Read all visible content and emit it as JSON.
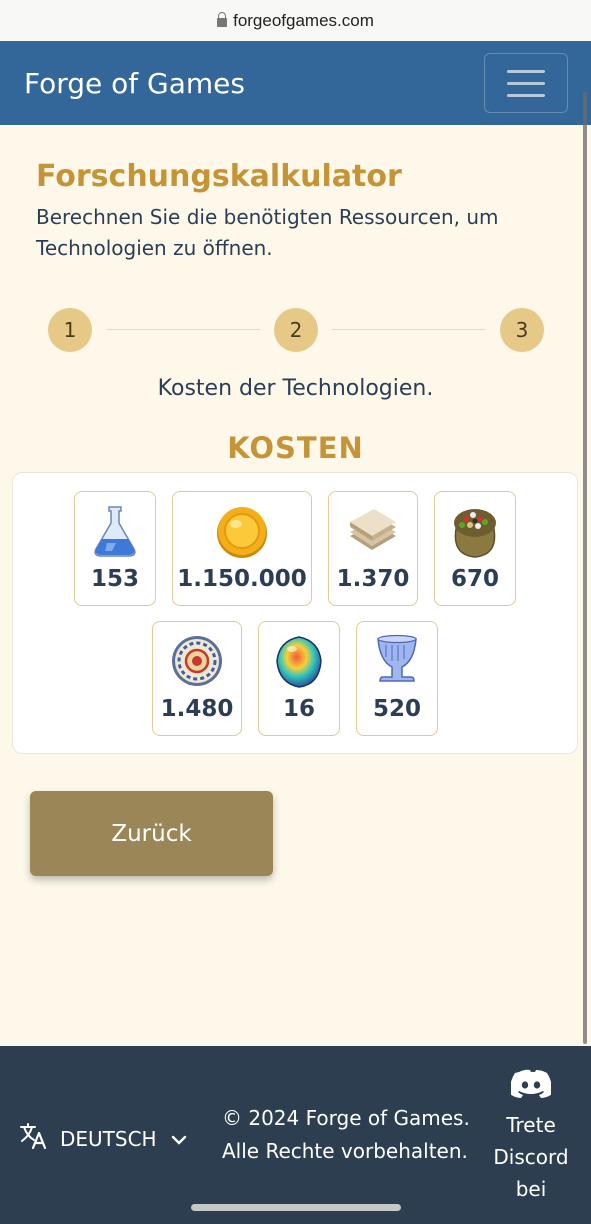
{
  "browser": {
    "url": "forgeofgames.com"
  },
  "navbar": {
    "brand": "Forge of Games"
  },
  "main": {
    "title": "Forschungskalkulator",
    "subtitle": "Berechnen Sie die benötigten Ressourcen, um Technologien zu öffnen.",
    "steps": [
      "1",
      "2",
      "3"
    ],
    "step_description": "Kosten der Technologien.",
    "costs_heading": "KOSTEN",
    "costs": [
      {
        "icon": "research-flask-icon",
        "value": "153"
      },
      {
        "icon": "coins-icon",
        "value": "1.150.000"
      },
      {
        "icon": "paper-stack-icon",
        "value": "1.370"
      },
      {
        "icon": "seed-sack-icon",
        "value": "670"
      },
      {
        "icon": "ornate-plate-icon",
        "value": "1.480"
      },
      {
        "icon": "opal-gem-icon",
        "value": "16"
      },
      {
        "icon": "glass-goblet-icon",
        "value": "520"
      }
    ],
    "back_button": "Zurück"
  },
  "footer": {
    "language": "DEUTSCH",
    "copyright_line1": "© 2024 Forge of Games.",
    "copyright_line2": "Alle Rechte vorbehalten.",
    "discord_line1": "Trete",
    "discord_line2": "Discord",
    "discord_line3": "bei"
  },
  "colors": {
    "navbar": "#336699",
    "background": "#fdf8ea",
    "accent_gold": "#c59436",
    "button": "#9a8657",
    "footer": "#2d3e51"
  }
}
